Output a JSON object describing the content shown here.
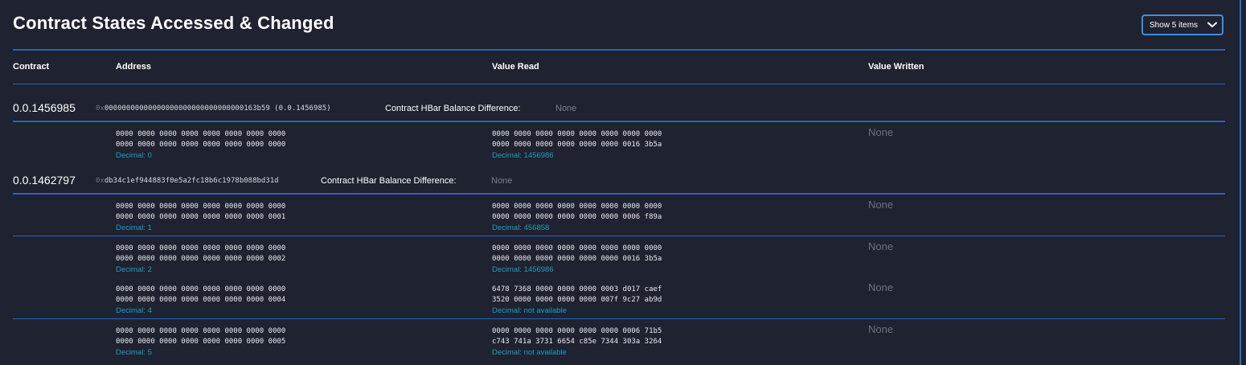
{
  "section": {
    "title": "Contract States Accessed & Changed",
    "page_size_select": "Show 5 items"
  },
  "table": {
    "headers": [
      "Contract",
      "Address",
      "Value Read",
      "Value Written"
    ]
  },
  "contracts": [
    {
      "id": "0.0.1456985",
      "address_prefix": "0x",
      "address_body": "00000000000000000000000000000000163b59",
      "address_suffix": "(0.0.1456985)",
      "balance_label": "Contract HBar Balance Difference:",
      "balance_value": "None"
    },
    {
      "id": "0.0.1462797",
      "address_prefix": "0x",
      "address_body": "db34c1ef944883f0e5a2fc18b6c1978b088bd31d",
      "address_suffix": "",
      "balance_label": "Contract HBar Balance Difference:",
      "balance_value": "None"
    }
  ],
  "rows": [
    {
      "address": [
        "0000 0000 0000 0000 0000 0000 0000 0000",
        "0000 0000 0000 0000 0000 0000 0000 0000"
      ],
      "address_decimal": "Decimal: 0",
      "value_read": [
        "0000 0000 0000 0000 0000 0000 0000 0000",
        "0000 0000 0000 0000 0000 0000 0016 3b5a"
      ],
      "value_read_decimal": "Decimal: 1456986",
      "value_written": "None"
    },
    {
      "address": [
        "0000 0000 0000 0000 0000 0000 0000 0000",
        "0000 0000 0000 0000 0000 0000 0000 0001"
      ],
      "address_decimal": "Decimal: 1",
      "value_read": [
        "0000 0000 0000 0000 0000 0000 0000 0000",
        "0000 0000 0000 0000 0000 0000 0006 f89a"
      ],
      "value_read_decimal": "Decimal: 456858",
      "value_written": "None"
    },
    {
      "address": [
        "0000 0000 0000 0000 0000 0000 0000 0000",
        "0000 0000 0000 0000 0000 0000 0000 0002"
      ],
      "address_decimal": "Decimal: 2",
      "value_read": [
        "0000 0000 0000 0000 0000 0000 0000 0000",
        "0000 0000 0000 0000 0000 0000 0016 3b5a"
      ],
      "value_read_decimal": "Decimal: 1456986",
      "value_written": "None"
    },
    {
      "address": [
        "0000 0000 0000 0000 0000 0000 0000 0000",
        "0000 0000 0000 0000 0000 0000 0000 0004"
      ],
      "address_decimal": "Decimal: 4",
      "value_read": [
        "6478 7368 0000 0000 0000 0003 d017 caef",
        "3520 0000 0000 0000 0000 007f 9c27 ab9d"
      ],
      "value_read_decimal": "Decimal: not available",
      "value_written": "None"
    },
    {
      "address": [
        "0000 0000 0000 0000 0000 0000 0000 0000",
        "0000 0000 0000 0000 0000 0000 0000 0005"
      ],
      "address_decimal": "Decimal: 5",
      "value_read": [
        "0000 0000 0000 0000 0000 0000 0006 71b5",
        "c743 741a 3731 6654 c85e 7344 303a 3264"
      ],
      "value_read_decimal": "Decimal: not available",
      "value_written": "None"
    }
  ],
  "colors": {
    "background": "#1f2230",
    "accent_blue": "#2e62b8",
    "decimal_text": "#1a9fc4",
    "muted_text": "#6d7180"
  }
}
